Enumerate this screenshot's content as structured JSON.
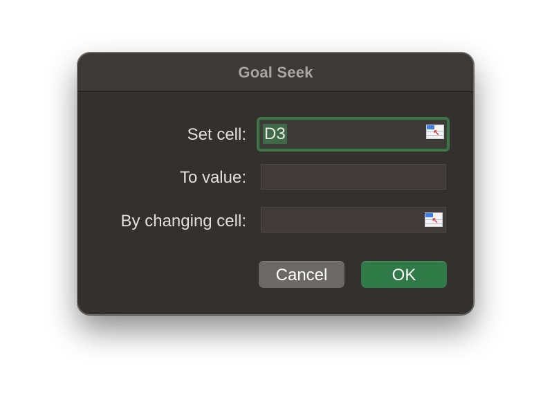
{
  "dialog": {
    "title": "Goal Seek",
    "set_cell": {
      "label": "Set cell:",
      "value": "D3",
      "picker_icon": "range-picker-icon"
    },
    "to_value": {
      "label": "To value:",
      "value": ""
    },
    "changing_cell": {
      "label": "By changing cell:",
      "value": "",
      "picker_icon": "range-picker-icon"
    },
    "buttons": {
      "cancel": "Cancel",
      "ok": "OK"
    }
  },
  "colors": {
    "dialog_bg": "#34302d",
    "focus_ring": "#3f7249",
    "ok_button": "#2f7a46",
    "cancel_button": "#6c6865"
  }
}
